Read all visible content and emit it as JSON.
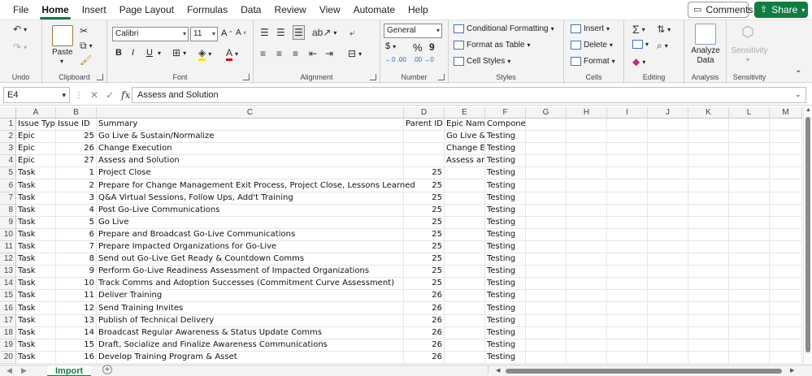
{
  "menu": {
    "items": [
      "File",
      "Home",
      "Insert",
      "Page Layout",
      "Formulas",
      "Data",
      "Review",
      "View",
      "Automate",
      "Help"
    ],
    "active": "Home",
    "comments_label": "Comments",
    "share_label": "Share"
  },
  "ribbon": {
    "undo_label": "Undo",
    "clipboard": {
      "label": "Clipboard",
      "paste_label": "Paste"
    },
    "font": {
      "label": "Font",
      "name": "Calibri",
      "size": "11",
      "grow": "A",
      "shrink": "A",
      "bold": "B",
      "italic": "I",
      "underline": "U",
      "color_letter": "A"
    },
    "alignment": {
      "label": "Alignment"
    },
    "number": {
      "label": "Number",
      "format": "General",
      "currency": "$",
      "percent": "%",
      "comma": "9",
      "inc_dec": "←0 .00",
      "dec_dec": ".00 →0"
    },
    "styles": {
      "label": "Styles",
      "conditional": "Conditional Formatting",
      "format_table": "Format as Table",
      "cell_styles": "Cell Styles"
    },
    "cells": {
      "label": "Cells",
      "insert": "Insert",
      "delete": "Delete",
      "format": "Format"
    },
    "editing": {
      "label": "Editing"
    },
    "analysis": {
      "label": "Analysis",
      "analyze_line1": "Analyze",
      "analyze_line2": "Data"
    },
    "sensitivity": {
      "label": "Sensitivity",
      "button": "Sensitivity"
    }
  },
  "formula_bar": {
    "cell_ref": "E4",
    "fx": "fx",
    "content": "Assess and Solution"
  },
  "sheet": {
    "columns": [
      "A",
      "B",
      "C",
      "D",
      "E",
      "F",
      "G",
      "H",
      "I",
      "J",
      "K",
      "L",
      "M"
    ],
    "rows": [
      [
        "1",
        "Issue Type",
        "Issue ID",
        "Summary",
        "Parent ID",
        "Epic Name",
        "Components"
      ],
      [
        "2",
        "Epic",
        "25",
        "Go Live & Sustain/Normalize",
        "",
        "Go Live &",
        "Testing"
      ],
      [
        "3",
        "Epic",
        "26",
        "Change Execution",
        "",
        "Change Ex",
        "Testing"
      ],
      [
        "4",
        "Epic",
        "27",
        "Assess and Solution",
        "",
        "Assess and",
        "Testing"
      ],
      [
        "5",
        "Task",
        "1",
        "Project Close",
        "25",
        "",
        "Testing"
      ],
      [
        "6",
        "Task",
        "2",
        "Prepare for Change Management Exit Process, Project Close, Lessons Learned",
        "25",
        "",
        "Testing"
      ],
      [
        "7",
        "Task",
        "3",
        "Q&A Virtual Sessions, Follow Ups, Add't Training",
        "25",
        "",
        "Testing"
      ],
      [
        "8",
        "Task",
        "4",
        "Post Go-Live Communications",
        "25",
        "",
        "Testing"
      ],
      [
        "9",
        "Task",
        "5",
        "Go Live",
        "25",
        "",
        "Testing"
      ],
      [
        "10",
        "Task",
        "6",
        "Prepare and Broadcast Go-Live Communications",
        "25",
        "",
        "Testing"
      ],
      [
        "11",
        "Task",
        "7",
        "Prepare Impacted Organizations for Go-Live",
        "25",
        "",
        "Testing"
      ],
      [
        "12",
        "Task",
        "8",
        "Send out Go-Live Get Ready & Countdown Comms",
        "25",
        "",
        "Testing"
      ],
      [
        "13",
        "Task",
        "9",
        "Perform Go-Live Readiness Assessment of Impacted Organizations",
        "25",
        "",
        "Testing"
      ],
      [
        "14",
        "Task",
        "10",
        "Track Comms and Adoption Successes (Commitment Curve Assessment)",
        "25",
        "",
        "Testing"
      ],
      [
        "15",
        "Task",
        "11",
        "Deliver Training",
        "26",
        "",
        "Testing"
      ],
      [
        "16",
        "Task",
        "12",
        "Send Training Invites",
        "26",
        "",
        "Testing"
      ],
      [
        "17",
        "Task",
        "13",
        "Publish of Technical Delivery",
        "26",
        "",
        "Testing"
      ],
      [
        "18",
        "Task",
        "14",
        "Broadcast Regular Awareness & Status Update Comms",
        "26",
        "",
        "Testing"
      ],
      [
        "19",
        "Task",
        "15",
        "Draft, Socialize and Finalize Awareness Communications",
        "26",
        "",
        "Testing"
      ],
      [
        "20",
        "Task",
        "16",
        "Develop Training Program & Asset",
        "26",
        "",
        "Testing"
      ]
    ]
  },
  "tabs": {
    "sheets": [
      "Import"
    ],
    "add_label": "+"
  }
}
